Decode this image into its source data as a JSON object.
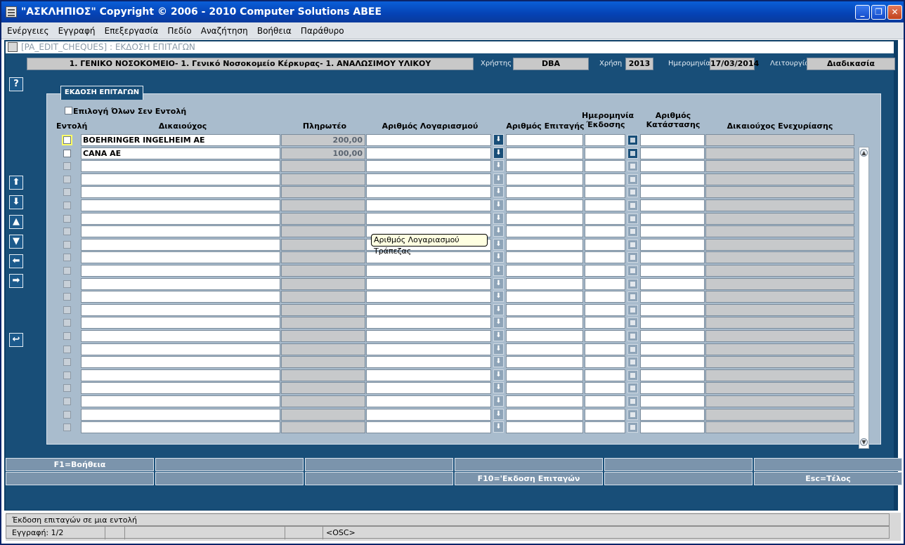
{
  "window": {
    "title": "\"ΑΣΚΛΗΠΙΟΣ\" Copyright © 2006 - 2010 Computer Solutions ABEE"
  },
  "menu": [
    "Ενέργειες",
    "Εγγραφή",
    "Επεξεργασία",
    "Πεδίο",
    "Αναζήτηση",
    "Βοήθεια",
    "Παράθυρο"
  ],
  "form_title": "[PA_EDIT_CHEQUES]   :   ΕΚΔΟΣΗ ΕΠΙΤΑΓΩΝ",
  "header": {
    "org": "1. ΓΕΝΙΚΟ ΝΟΣΟΚΟΜΕΙΟ- 1. Γενικό Νοσοκομείο Κέρκυρας- 1. ΑΝΑΛΩΣΙΜΟΥ ΥΛΙΚΟΥ",
    "user_label": "Χρήστης",
    "user": "DBA",
    "year_label": "Χρήση",
    "year": "2013",
    "date_label": "Ημερομηνία",
    "date": "17/03/2014",
    "mode_label": "Λειτουργία",
    "mode": "Διαδικασία"
  },
  "panel": {
    "tab": "ΕΚΔΟΣΗ ΕΠΙΤΑΓΩΝ",
    "select_all": "Επιλογή Όλων Σεν Εντολή"
  },
  "columns": {
    "entoli": "Εντολή",
    "dikaiouxos": "Δικαιούχος",
    "pliroteo": "Πληρωτέο",
    "logariasmos": "Αριθμός Λογαριασμού",
    "epitagi": "Αριθμός Επιταγής",
    "imerominia": "Ημερομηνία Έκδοσης",
    "katastasi": "Αριθμός Κατάστασης",
    "enexyriasi": "Δικαιούχος Ενεχυρίασης"
  },
  "rows": [
    {
      "dikaiouxos": "BOEHRINGER INGELHEIM AE",
      "pliroteo": "200,00"
    },
    {
      "dikaiouxos": "CANA AE",
      "pliroteo": "100,00"
    }
  ],
  "tooltip": "Αριθμός Λογαριασμού Τράπεζας",
  "fkeys_row1": [
    "F1=Βοήθεια",
    "",
    "",
    "",
    "",
    ""
  ],
  "fkeys_row2": [
    "",
    "",
    "",
    "F10='Εκδοση Επιταγών",
    "",
    "Esc=Τέλος"
  ],
  "status": {
    "message": "Έκδοση επιταγών σε μια εντολή",
    "record": "Εγγραφή: 1/2",
    "osc": "<OSC>"
  },
  "side_buttons": [
    "help-icon",
    "arrow-up-icon",
    "arrow-down-icon",
    "triangle-up-icon",
    "triangle-down-icon",
    "arrow-left-icon",
    "arrow-right-icon",
    "undo-icon"
  ]
}
